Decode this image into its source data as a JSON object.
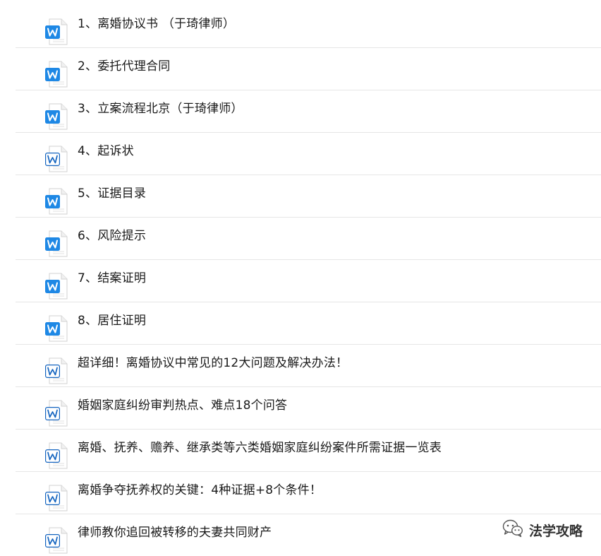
{
  "files": [
    {
      "name": "1、离婚协议书 （于琦律师）",
      "icon": "word-doc-icon",
      "style": "solid"
    },
    {
      "name": "2、委托代理合同",
      "icon": "word-doc-icon",
      "style": "solid"
    },
    {
      "name": "3、立案流程北京（于琦律师）",
      "icon": "word-doc-icon",
      "style": "solid"
    },
    {
      "name": "4、起诉状",
      "icon": "word-doc-icon",
      "style": "outline"
    },
    {
      "name": "5、证据目录",
      "icon": "word-doc-icon",
      "style": "solid"
    },
    {
      "name": "6、风险提示",
      "icon": "word-doc-icon",
      "style": "solid"
    },
    {
      "name": "7、结案证明",
      "icon": "word-doc-icon",
      "style": "solid"
    },
    {
      "name": "8、居住证明",
      "icon": "word-doc-icon",
      "style": "solid"
    },
    {
      "name": "超详细！离婚协议中常见的12大问题及解决办法！",
      "icon": "word-doc-icon",
      "style": "outline"
    },
    {
      "name": "婚姻家庭纠纷审判热点、难点18个问答",
      "icon": "word-doc-icon",
      "style": "outline"
    },
    {
      "name": "离婚、抚养、赡养、继承类等六类婚姻家庭纠纷案件所需证据一览表",
      "icon": "word-doc-icon",
      "style": "outline"
    },
    {
      "name": "离婚争夺抚养权的关键：4种证据+8个条件！",
      "icon": "word-doc-icon",
      "style": "outline"
    },
    {
      "name": "律师教你追回被转移的夫妻共同财产",
      "icon": "word-doc-icon",
      "style": "outline"
    }
  ],
  "watermark": {
    "text": "法学攻略",
    "icon": "wechat-icon"
  },
  "colors": {
    "word_blue": "#1e88e5",
    "word_blue_dark": "#1565c0",
    "divider": "#e6e6e6",
    "text": "#1a1a1a"
  }
}
